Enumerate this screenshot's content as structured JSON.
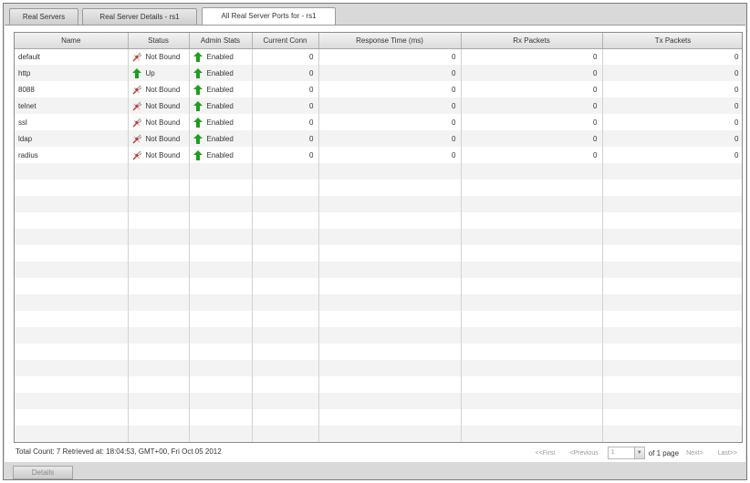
{
  "tabs": [
    {
      "label": "Real Servers"
    },
    {
      "label": "Real Server Details - rs1"
    },
    {
      "label": "All Real Server Ports for - rs1"
    }
  ],
  "columns": [
    "Name",
    "Status",
    "Admin Stats",
    "Current Conn",
    "Response Time (ms)",
    "Rx Packets",
    "Tx Packets"
  ],
  "rows": [
    {
      "name": "default",
      "status": "Not Bound",
      "status_icon": "unbound-plug-icon",
      "admin": "Enabled",
      "admin_icon": "up-arrow-icon",
      "conn": "0",
      "resp": "0",
      "rx": "0",
      "tx": "0"
    },
    {
      "name": "http",
      "status": "Up",
      "status_icon": "up-arrow-icon",
      "admin": "Enabled",
      "admin_icon": "up-arrow-icon",
      "conn": "0",
      "resp": "0",
      "rx": "0",
      "tx": "0"
    },
    {
      "name": "8088",
      "status": "Not Bound",
      "status_icon": "unbound-plug-icon",
      "admin": "Enabled",
      "admin_icon": "up-arrow-icon",
      "conn": "0",
      "resp": "0",
      "rx": "0",
      "tx": "0"
    },
    {
      "name": "telnet",
      "status": "Not Bound",
      "status_icon": "unbound-plug-icon",
      "admin": "Enabled",
      "admin_icon": "up-arrow-icon",
      "conn": "0",
      "resp": "0",
      "rx": "0",
      "tx": "0"
    },
    {
      "name": "ssl",
      "status": "Not Bound",
      "status_icon": "unbound-plug-icon",
      "admin": "Enabled",
      "admin_icon": "up-arrow-icon",
      "conn": "0",
      "resp": "0",
      "rx": "0",
      "tx": "0"
    },
    {
      "name": "ldap",
      "status": "Not Bound",
      "status_icon": "unbound-plug-icon",
      "admin": "Enabled",
      "admin_icon": "up-arrow-icon",
      "conn": "0",
      "resp": "0",
      "rx": "0",
      "tx": "0"
    },
    {
      "name": "radius",
      "status": "Not Bound",
      "status_icon": "unbound-plug-icon",
      "admin": "Enabled",
      "admin_icon": "up-arrow-icon",
      "conn": "0",
      "resp": "0",
      "rx": "0",
      "tx": "0"
    }
  ],
  "footer": {
    "summary": "Total Count: 7  Retrieved at: 18:04:53, GMT+00, Fri Oct 05 2012",
    "first": "<<First",
    "previous": "<Previous",
    "page_value": "1",
    "of_pages": "of 1 page",
    "next": "Next>",
    "last": "Last>>"
  },
  "bottom": {
    "details_label": "Details"
  },
  "colors": {
    "up_green": "#1aa11a",
    "plug_red": "#c0392b"
  }
}
